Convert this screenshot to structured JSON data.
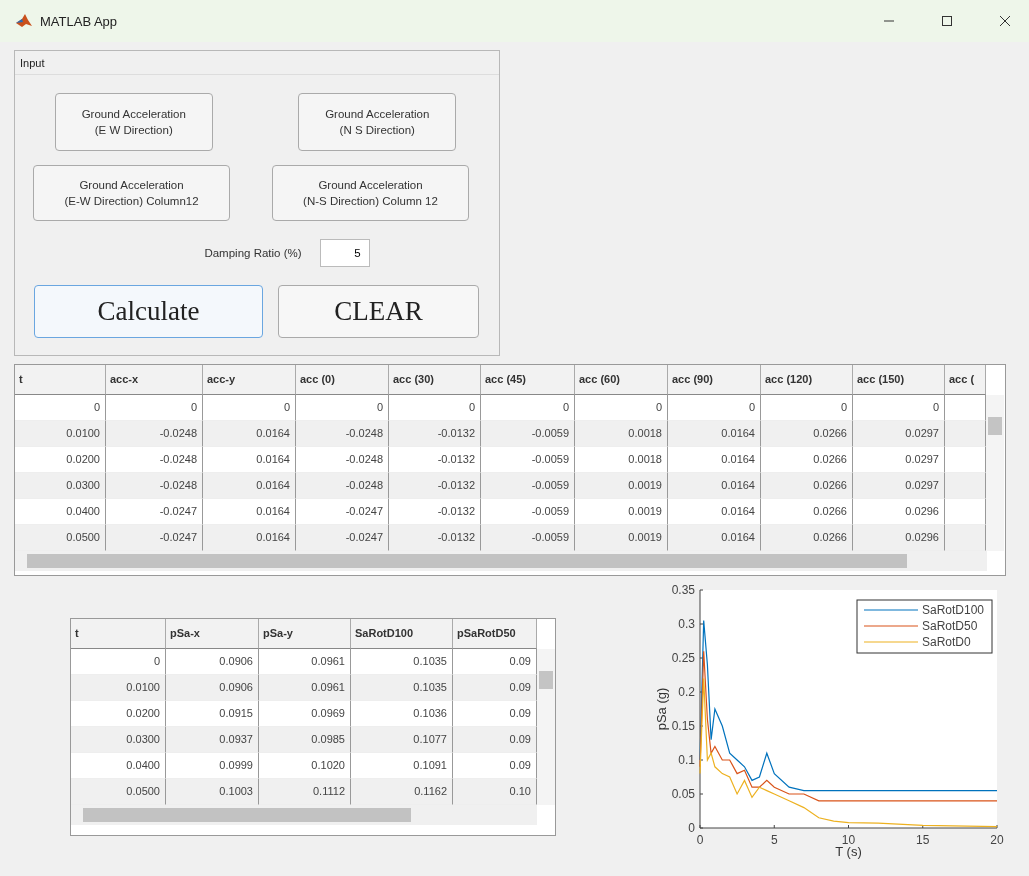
{
  "window": {
    "title": "MATLAB App"
  },
  "input_panel": {
    "title": "Input",
    "load_buttons": [
      "Ground Acceleration\n(E W Direction)",
      "Ground Acceleration\n(N S Direction)",
      "Ground Acceleration\n(E-W Direction) Column12",
      "Ground Acceleration\n(N-S Direction) Column 12"
    ],
    "damping": {
      "label": "Damping Ratio (%)",
      "value": "5"
    },
    "action_buttons": [
      {
        "label": "Calculate",
        "focused": true
      },
      {
        "label": "CLEAR",
        "focused": false
      }
    ]
  },
  "acceleration_table": {
    "columns": [
      "t",
      "acc-x",
      "acc-y",
      "acc (0)",
      "acc (30)",
      "acc (45)",
      "acc (60)",
      "acc (90)",
      "acc (120)",
      "acc (150)",
      "acc ("
    ],
    "rows": [
      [
        "0",
        "0",
        "0",
        "0",
        "0",
        "0",
        "0",
        "0",
        "0",
        "0"
      ],
      [
        "0.0100",
        "-0.0248",
        "0.0164",
        "-0.0248",
        "-0.0132",
        "-0.0059",
        "0.0018",
        "0.0164",
        "0.0266",
        "0.0297"
      ],
      [
        "0.0200",
        "-0.0248",
        "0.0164",
        "-0.0248",
        "-0.0132",
        "-0.0059",
        "0.0018",
        "0.0164",
        "0.0266",
        "0.0297"
      ],
      [
        "0.0300",
        "-0.0248",
        "0.0164",
        "-0.0248",
        "-0.0132",
        "-0.0059",
        "0.0019",
        "0.0164",
        "0.0266",
        "0.0297"
      ],
      [
        "0.0400",
        "-0.0247",
        "0.0164",
        "-0.0247",
        "-0.0132",
        "-0.0059",
        "0.0019",
        "0.0164",
        "0.0266",
        "0.0296"
      ],
      [
        "0.0500",
        "-0.0247",
        "0.0164",
        "-0.0247",
        "-0.0132",
        "-0.0059",
        "0.0019",
        "0.0164",
        "0.0266",
        "0.0296"
      ]
    ]
  },
  "spectrum_table": {
    "columns": [
      "t",
      "pSa-x",
      "pSa-y",
      "SaRotD100",
      "pSaRotD50"
    ],
    "rows": [
      [
        "0",
        "0.0906",
        "0.0961",
        "0.1035",
        "0.09"
      ],
      [
        "0.0100",
        "0.0906",
        "0.0961",
        "0.1035",
        "0.09"
      ],
      [
        "0.0200",
        "0.0915",
        "0.0969",
        "0.1036",
        "0.09"
      ],
      [
        "0.0300",
        "0.0937",
        "0.0985",
        "0.1077",
        "0.09"
      ],
      [
        "0.0400",
        "0.0999",
        "0.1020",
        "0.1091",
        "0.09"
      ],
      [
        "0.0500",
        "0.1003",
        "0.1112",
        "0.1162",
        "0.10"
      ]
    ]
  },
  "chart": {
    "chart_data": {
      "type": "line",
      "xlabel": "T (s)",
      "ylabel": "pSa (g)",
      "x": [
        0,
        0.25,
        0.5,
        0.75,
        1,
        1.5,
        2,
        2.5,
        3,
        3.5,
        4,
        4.5,
        5,
        6,
        7,
        8,
        9,
        10,
        12,
        15,
        20
      ],
      "series": [
        {
          "name": "SaRotD100",
          "color": "#0072bd",
          "values": [
            0.1,
            0.305,
            0.24,
            0.13,
            0.175,
            0.15,
            0.11,
            0.1,
            0.09,
            0.07,
            0.075,
            0.11,
            0.08,
            0.06,
            0.055,
            0.055,
            0.055,
            0.055,
            0.055,
            0.055,
            0.055
          ]
        },
        {
          "name": "SaRotD50",
          "color": "#d95319",
          "values": [
            0.09,
            0.26,
            0.16,
            0.11,
            0.12,
            0.1,
            0.1,
            0.08,
            0.085,
            0.06,
            0.06,
            0.07,
            0.06,
            0.05,
            0.05,
            0.04,
            0.04,
            0.04,
            0.04,
            0.04,
            0.04
          ]
        },
        {
          "name": "SaRotD0",
          "color": "#edb120",
          "values": [
            0.08,
            0.22,
            0.1,
            0.11,
            0.09,
            0.08,
            0.075,
            0.05,
            0.07,
            0.045,
            0.06,
            0.055,
            0.05,
            0.04,
            0.03,
            0.015,
            0.01,
            0.008,
            0.007,
            0.004,
            0.002
          ]
        }
      ],
      "legend": true,
      "xlim": [
        0,
        20
      ],
      "ylim": [
        0,
        0.35
      ],
      "xticks": [
        0,
        5,
        10,
        15,
        20
      ],
      "yticks": [
        0,
        {
          "value": 0.05,
          "label": "0.05"
        },
        {
          "value": 0.1,
          "label": "0.1"
        },
        {
          "value": 0.15,
          "label": "0.15"
        },
        {
          "value": 0.2,
          "label": "0.2"
        },
        {
          "value": 0.25,
          "label": "0.25"
        },
        {
          "value": 0.3,
          "label": "0.3"
        },
        {
          "value": 0.35,
          "label": "0.35"
        }
      ]
    }
  }
}
